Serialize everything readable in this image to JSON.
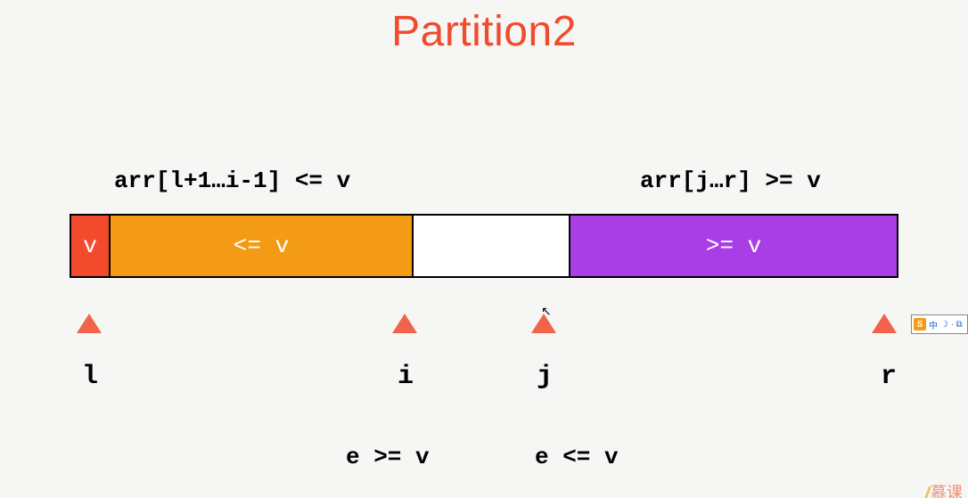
{
  "title": "Partition2",
  "annotations": {
    "left_range": "arr[l+1…i-1] <= v",
    "right_range": "arr[j…r] >= v",
    "cond_left": "e >= v",
    "cond_right": "e <= v"
  },
  "segments": {
    "pivot": "v",
    "le": "<= v",
    "ge": ">= v"
  },
  "pointers": {
    "l": "l",
    "i": "i",
    "j": "j",
    "r": "r"
  },
  "ime": {
    "badge": "S",
    "text": "中",
    "moon": "☽",
    "dots": "∙ ⧉"
  },
  "watermark": "慕课"
}
